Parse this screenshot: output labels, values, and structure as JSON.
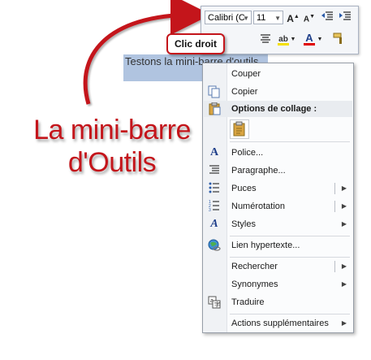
{
  "toolbar": {
    "font_name": "Calibri (C",
    "font_size": "11"
  },
  "callout": {
    "text": "Clic droit"
  },
  "document": {
    "selected_text": "Testons la mini-barre d'outils"
  },
  "menu": {
    "cut": "Couper",
    "copy": "Copier",
    "paste_options": "Options de collage :",
    "font": "Police...",
    "paragraph": "Paragraphe...",
    "bullets": "Puces",
    "numbering": "Numérotation",
    "styles": "Styles",
    "hyperlink": "Lien hypertexte...",
    "search": "Rechercher",
    "synonyms": "Synonymes",
    "translate": "Traduire",
    "additional": "Actions supplémentaires"
  },
  "annotation": {
    "line1": "La mini-barre",
    "line2": "d'Outils"
  },
  "colors": {
    "accent": "#c4151b",
    "selection": "#b0c4e0"
  }
}
